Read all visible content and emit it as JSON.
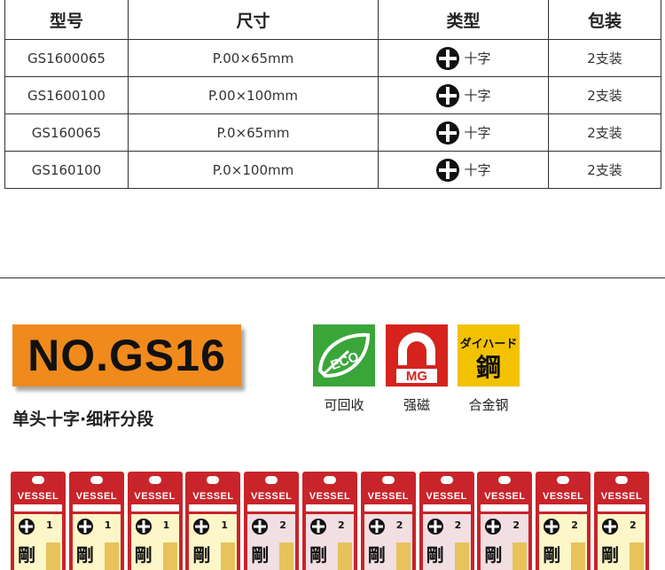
{
  "table": {
    "headers": [
      "型号",
      "尺寸",
      "类型",
      "包装"
    ],
    "rows": [
      {
        "model": "GS1600065",
        "size": "P.00×65mm",
        "type": "十字",
        "pack": "2支装"
      },
      {
        "model": "GS1600100",
        "size": "P.00×100mm",
        "type": "十字",
        "pack": "2支装"
      },
      {
        "model": "GS160065",
        "size": "P.0×65mm",
        "type": "十字",
        "pack": "2支装"
      },
      {
        "model": "GS160100",
        "size": "P.0×100mm",
        "type": "十字",
        "pack": "2支装"
      }
    ]
  },
  "product": {
    "model_badge": "NO.GS16",
    "subtitle": "单头十字·细杆分段",
    "accent_color": "#f08a1c"
  },
  "features": [
    {
      "icon": "eco-leaf-icon",
      "text": "ECO",
      "label": "可回收",
      "color": "#3aa63a"
    },
    {
      "icon": "magnet-icon",
      "text": "MG",
      "label": "强磁",
      "color": "#d6231e"
    },
    {
      "icon": "hard-steel-icon",
      "text": "ダイハード鋼",
      "label": "合金钢",
      "color": "#f2c200"
    }
  ],
  "packages": {
    "brand": "VESSEL",
    "kanji": "剛",
    "items": [
      {
        "num": "1",
        "window": "yellow"
      },
      {
        "num": "1",
        "window": "yellow"
      },
      {
        "num": "1",
        "window": "yellow"
      },
      {
        "num": "1",
        "window": "yellow"
      },
      {
        "num": "2",
        "window": "pink"
      },
      {
        "num": "2",
        "window": "pink"
      },
      {
        "num": "2",
        "window": "pink"
      },
      {
        "num": "2",
        "window": "pink"
      },
      {
        "num": "2",
        "window": "pink"
      },
      {
        "num": "2",
        "window": "yellow"
      },
      {
        "num": "2",
        "window": "yellow"
      }
    ]
  }
}
